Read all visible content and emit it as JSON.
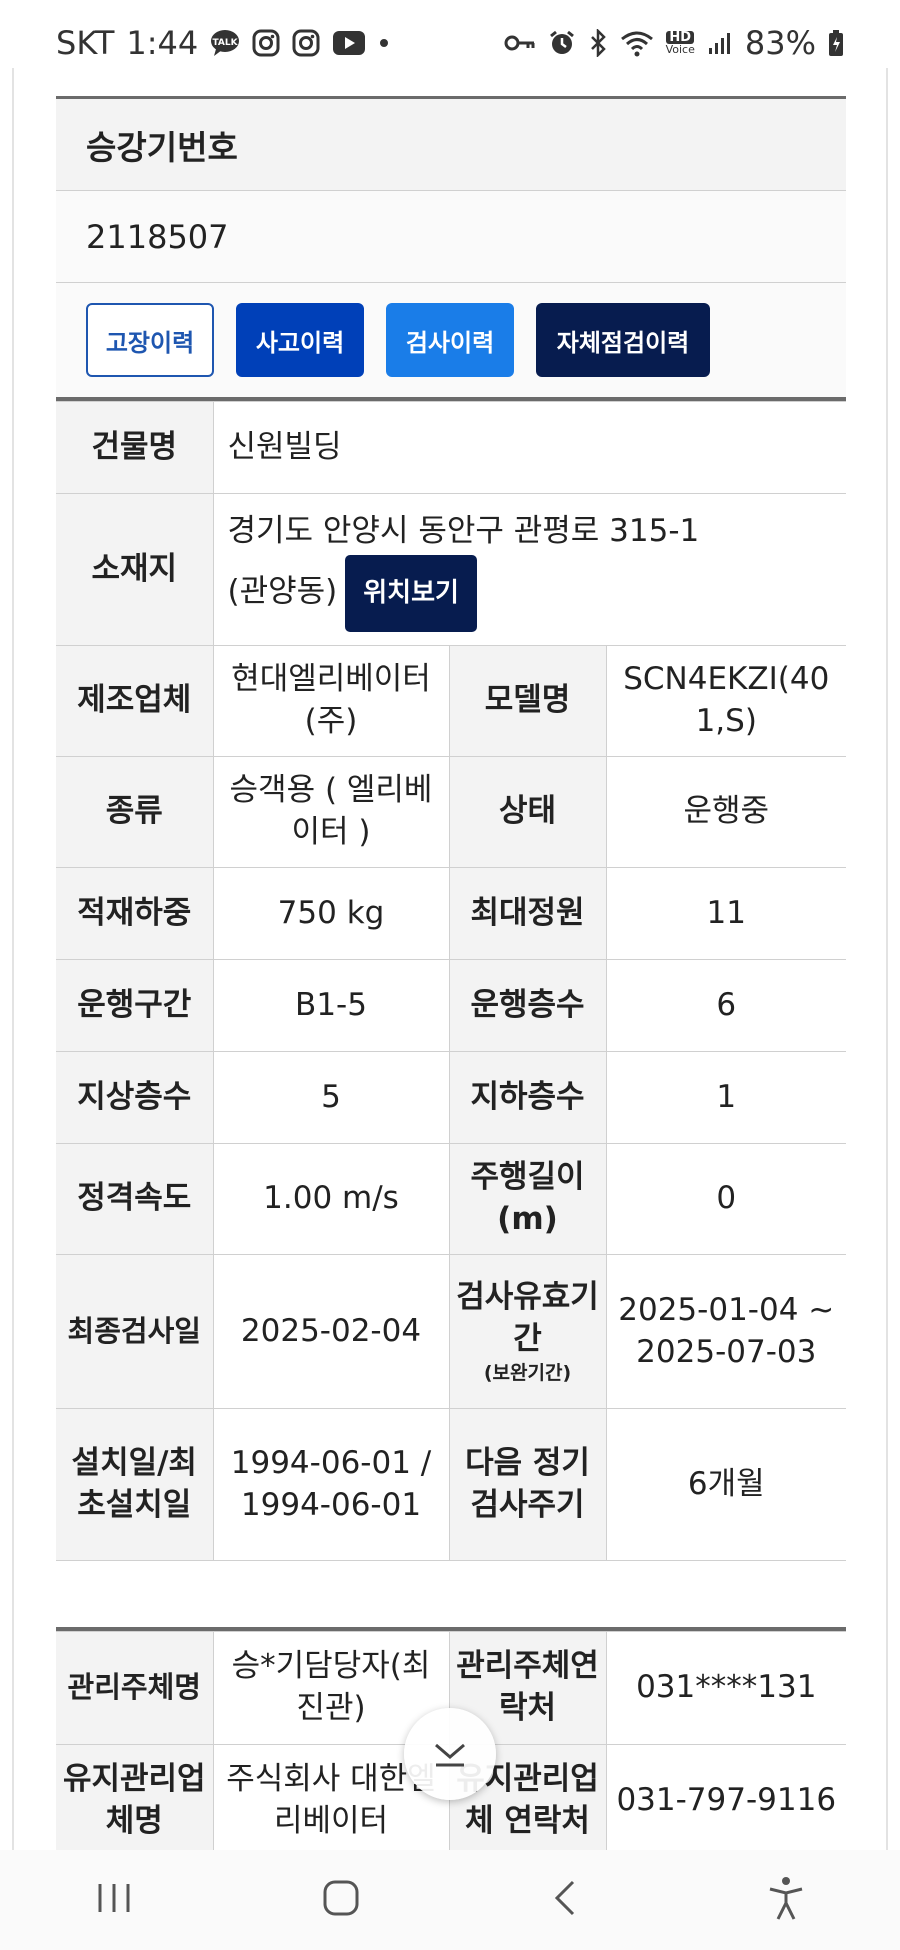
{
  "status": {
    "carrier": "SKT",
    "time": "1:44",
    "battery": "83%",
    "left_icons": [
      "talk-icon",
      "instagram-icon",
      "instagram-icon",
      "youtube-icon",
      "dot-icon"
    ],
    "right_icons": [
      "key-icon",
      "alarm-icon",
      "bluetooth-icon",
      "wifi-icon",
      "hd-voice-icon",
      "signal-icon",
      "battery-icon"
    ],
    "hd_label": "HD",
    "voice_label": "Voice"
  },
  "elevator": {
    "number_label": "승강기번호",
    "number_value": "2118507"
  },
  "buttons": {
    "failure_history": "고장이력",
    "accident_history": "사고이력",
    "inspection_history": "검사이력",
    "self_check_history": "자체점검이력"
  },
  "details": {
    "building_label": "건물명",
    "building_value": "신원빌딩",
    "location_label": "소재지",
    "location_value_line1": "경기도 안양시 동안구 관평로 315-1",
    "location_value_line2": "(관양동)",
    "location_button": "위치보기",
    "manufacturer_label": "제조업체",
    "manufacturer_value": "현대엘리베이터(주)",
    "model_label": "모델명",
    "model_value": "SCN4EKZI(401,S)",
    "type_label": "종류",
    "type_value": "승객용 ( 엘리베이터 )",
    "state_label": "상태",
    "state_value": "운행중",
    "load_label": "적재하중",
    "load_value": "750 kg",
    "capacity_label": "최대정원",
    "capacity_value": "11",
    "section_label": "운행구간",
    "section_value": "B1-5",
    "floors_label": "운행층수",
    "floors_value": "6",
    "ground_label": "지상층수",
    "ground_value": "5",
    "underground_label": "지하층수",
    "underground_value": "1",
    "speed_label": "정격속도",
    "speed_value": "1.00 m/s",
    "travel_label": "주행길이(m)",
    "travel_value": "0",
    "last_inspection_label": "최종검사일",
    "last_inspection_value": "2025-02-04",
    "validity_label": "검사유효기간",
    "validity_sub": "(보완기간)",
    "validity_value": "2025-01-04 ~ 2025-07-03",
    "install_label": "설치일/최초설치일",
    "install_value": "1994-06-01 / 1994-06-01",
    "next_cycle_label": "다음 정기검사주기",
    "next_cycle_value": "6개월"
  },
  "management": {
    "entity_label": "관리주체명",
    "entity_value": "승*기담당자(최진관)",
    "entity_contact_label": "관리주체연락처",
    "entity_contact_value": "031****131",
    "maint_label": "유지관리업체명",
    "maint_value": "주식회사 대한엘리베이터",
    "maint_contact_label": "유지관리업체 연락처",
    "maint_contact_value": "031-797-9116"
  },
  "nav": [
    "recent-apps-icon",
    "home-icon",
    "back-icon",
    "accessibility-icon"
  ],
  "colors": {
    "primary_dark": "#071c4f",
    "primary": "#0040b8",
    "accent": "#1a7de8",
    "label_bg": "#f3f3f3"
  }
}
